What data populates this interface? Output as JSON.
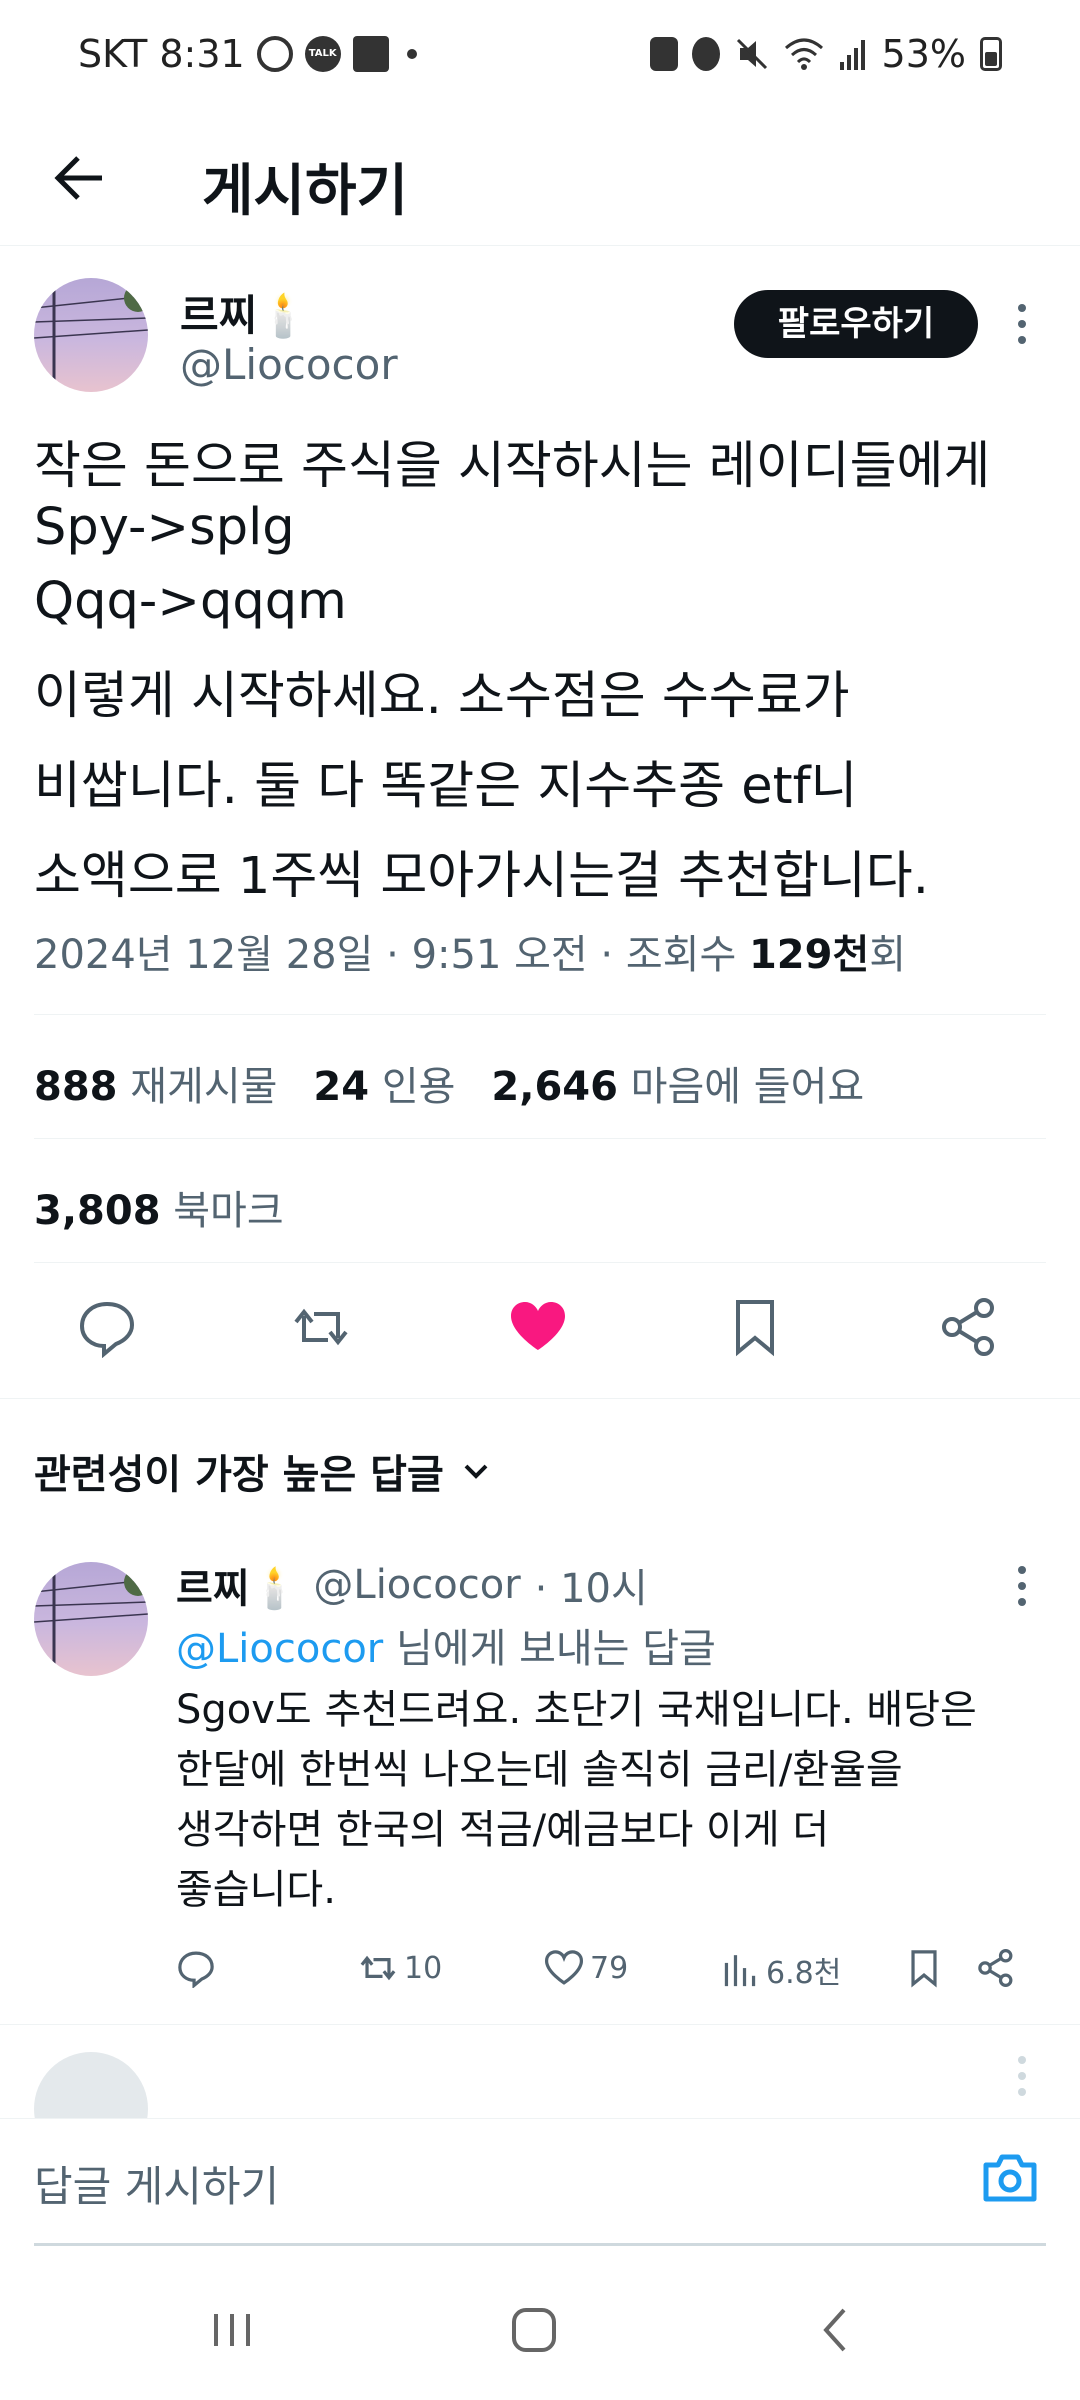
{
  "status_bar": {
    "carrier_time": "SKT 8:31",
    "battery": "53%"
  },
  "header": {
    "title": "게시하기"
  },
  "post": {
    "name": "르찌🕯️",
    "handle": "@Liococor",
    "follow_label": "팔로우하기",
    "lines": [
      "작은 돈으로 주식을 시작하시는 레이디들에게",
      "Spy->splg",
      "Qqq->qqqm",
      "이렇게 시작하세요. 소수점은 수수료가",
      "비쌉니다. 둘 다 똑같은 지수추종 etf니",
      "소액으로 1주씩 모아가시는걸 추천합니다."
    ],
    "meta_prefix": "2024년 12월 28일 · 9:51 오전 · 조회수 ",
    "views": "129천",
    "views_suffix": "회",
    "stats": {
      "reposts": "888",
      "reposts_label": "재게시물",
      "quotes": "24",
      "quotes_label": "인용",
      "likes": "2,646",
      "likes_label": "마음에 들어요",
      "bookmarks": "3,808",
      "bookmarks_label": "북마크"
    }
  },
  "sort_label": "관련성이 가장 높은 답글",
  "reply": {
    "name": "르찌🕯️",
    "handle": "@Liococor",
    "time": "· 10시",
    "reply_to_handle": "@Liococor",
    "reply_to_suffix": " 님에게 보내는 답글",
    "body_lines": [
      "Sgov도 추천드려요. 초단기 국채입니다. 배당은",
      "한달에 한번씩 나오는데 솔직히 금리/환율을",
      "생각하면 한국의 적금/예금보다 이게 더",
      "좋습니다."
    ],
    "reposts": "10",
    "likes": "79",
    "views": "6.8천"
  },
  "compose": {
    "placeholder": "답글 게시하기"
  },
  "colors": {
    "like_active": "#f91880",
    "link": "#1d9bf0",
    "text": "#0f1419",
    "secondary": "#536471"
  }
}
